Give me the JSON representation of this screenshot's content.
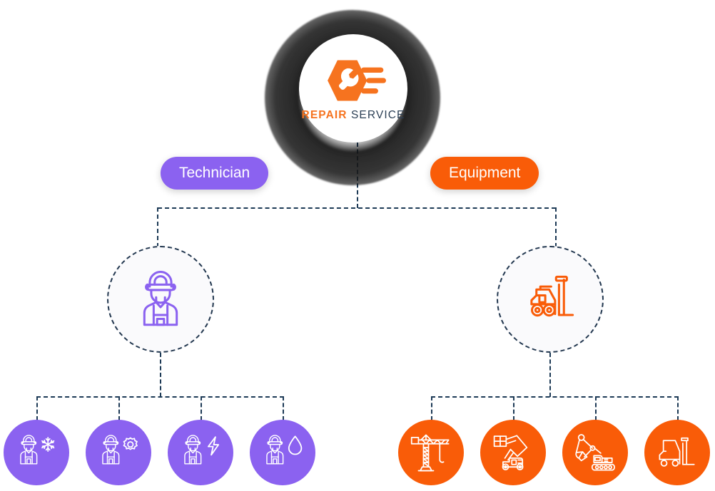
{
  "diagram": {
    "title": "Repair Service org chart",
    "colors": {
      "purple": "#8B62F0",
      "orange": "#F95C08",
      "connector": "#1d3a56",
      "node_bg": "#FAFAFC",
      "logo_orange": "#F6731F",
      "logo_navy": "#2b3f55"
    }
  },
  "root": {
    "name": "repair-service-logo",
    "icon": "hexagon-wrench-speed-icon",
    "wordmark_primary": "REPAIR",
    "wordmark_secondary": "SERVICE"
  },
  "branches": [
    {
      "id": "technician",
      "pill_label": "Technician",
      "pill_color": "#8B62F0",
      "node_icon": "worker-technician-icon",
      "node_icon_color": "#8B62F0",
      "children": [
        {
          "id": "hvac",
          "icon": "worker-snowflake-icon"
        },
        {
          "id": "mechanic",
          "icon": "worker-gear-icon"
        },
        {
          "id": "electrician",
          "icon": "worker-lightning-icon"
        },
        {
          "id": "plumber",
          "icon": "worker-waterdrop-icon"
        }
      ]
    },
    {
      "id": "equipment",
      "pill_label": "Equipment",
      "pill_color": "#F95C08",
      "node_icon": "forklift-icon",
      "node_icon_color": "#F95C08",
      "children": [
        {
          "id": "tower-crane",
          "icon": "tower-crane-icon"
        },
        {
          "id": "boom-lift",
          "icon": "boom-lift-icon"
        },
        {
          "id": "excavator",
          "icon": "excavator-icon"
        },
        {
          "id": "forklift",
          "icon": "forklift-icon"
        }
      ]
    }
  ]
}
